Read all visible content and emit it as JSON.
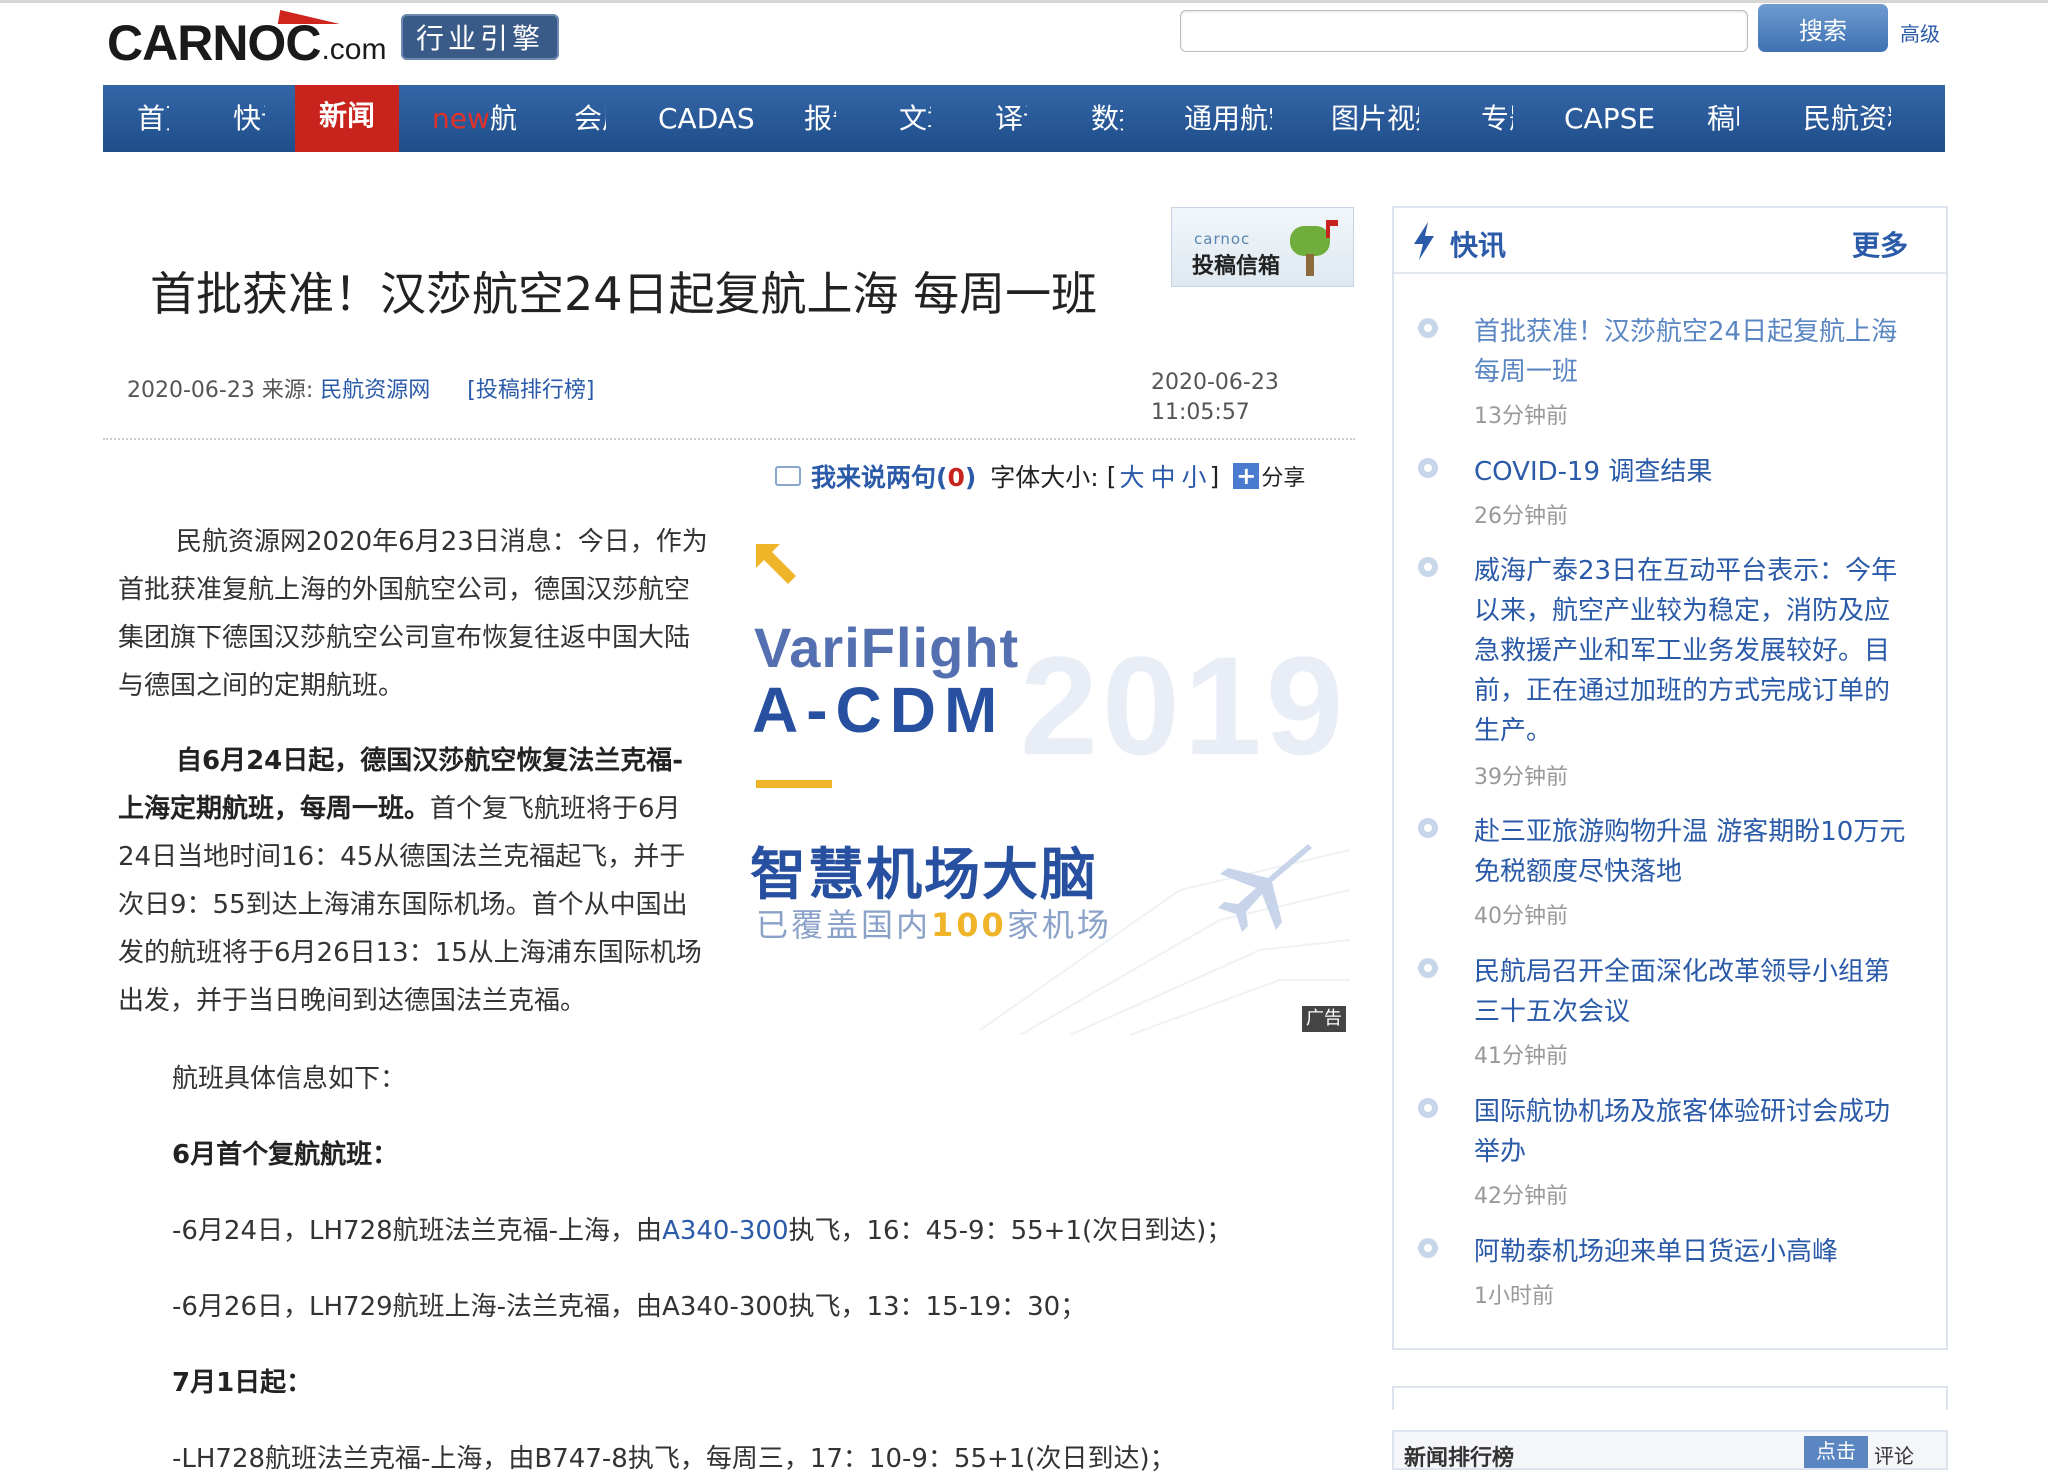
{
  "header": {
    "logo_main": "CARNOC",
    "logo_com": ".com",
    "badge": "行业引擎",
    "search_placeholder": "",
    "search_button": "搜索",
    "advanced": "高级"
  },
  "nav": [
    {
      "label": "首页",
      "left": 0
    },
    {
      "label": "快讯"
    },
    {
      "label": "新闻",
      "active": true
    },
    {
      "label_new": "new",
      "label": "航旅"
    },
    {
      "label": "会展"
    },
    {
      "label": "CADAS"
    },
    {
      "label": "报告"
    },
    {
      "label": "文章"
    },
    {
      "label": "译讯"
    },
    {
      "label": "数据"
    },
    {
      "label": "通用航空"
    },
    {
      "label": "图片视频"
    },
    {
      "label": "专题"
    },
    {
      "label": "CAPSE"
    },
    {
      "label": "稿明"
    },
    {
      "label": "民航资料"
    }
  ],
  "article": {
    "title": "首批获准！汉莎航空24日起复航上海 每周一班",
    "date": "2020-06-23",
    "source_label": "来源:",
    "source": "民航资源网",
    "rank_link": "投稿排行榜",
    "time_date": "2020-06-23",
    "time_clock": "11:05:57",
    "tougao_small": "carnoc",
    "tougao": "投稿信箱",
    "comment_label": "我来说两句",
    "comment_count": "0",
    "font_size_label": "字体大小:",
    "font_large": "大",
    "font_medium": "中",
    "font_small": "小",
    "share": "分享",
    "p1": "民航资源网2020年6月23日消息：今日，作为首批获准复航上海的外国航空公司，德国汉莎航空集团旗下德国汉莎航空公司宣布恢复往返中国大陆与德国之间的定期航班。",
    "p2_bold": "自6月24日起，德国汉莎航空恢复法兰克福-上海定期航班，每周一班。",
    "p2_rest": "首个复飞航班将于6月24日当地时间16：45从德国法兰克福起飞，并于次日9：55到达上海浦东国际机场。首个从中国出发的航班将于6月26日13：15从上海浦东国际机场出发，并于当日晚间到达德国法兰克福。",
    "p3": "航班具体信息如下：",
    "h1": "6月首个复航航班：",
    "l1_a": "-6月24日，LH728航班法兰克福-上海，由",
    "l1_link": "A340-300",
    "l1_b": "执飞，16：45-9：55+1(次日到达)；",
    "l2": "-6月26日，LH729航班上海-法兰克福，由A340-300执飞，13：15-19：30；",
    "h2": "7月1日起：",
    "l3": "-LH728航班法兰克福-上海，由B747-8执飞，每周三，17：10-9：55+1(次日到达)；"
  },
  "ad": {
    "brand1": "VariFlight",
    "brand2": "A-CDM",
    "year": "2019",
    "headline": "智慧机场大脑",
    "sub_a": "已覆盖国内",
    "sub_num": "100",
    "sub_b": "家机场",
    "tag": "广告",
    "colors": {
      "brand": "#2850a0",
      "accent": "#f0b429"
    }
  },
  "sidebar": {
    "title": "快讯",
    "more": "更多",
    "items": [
      {
        "text": "首批获准！汉莎航空24日起复航上海 每周一班",
        "time": "13分钟前"
      },
      {
        "text": "COVID-19 调查结果",
        "time": "26分钟前"
      },
      {
        "text": "威海广泰23日在互动平台表示：今年以来，航空产业较为稳定，消防及应急救援产业和军工业务发展较好。目前，正在通过加班的方式完成订单的生产。",
        "time": "39分钟前"
      },
      {
        "text": "赴三亚旅游购物升温 游客期盼10万元免税额度尽快落地",
        "time": "40分钟前"
      },
      {
        "text": "民航局召开全面深化改革领导小组第三十五次会议",
        "time": "41分钟前"
      },
      {
        "text": "国际航协机场及旅客体验研讨会成功举办",
        "time": "42分钟前"
      },
      {
        "text": "阿勒泰机场迎来单日货运小高峰",
        "time": "1小时前"
      }
    ],
    "rank_title": "新闻排行榜",
    "rank_tab1": "点击",
    "rank_tab2": "评论"
  }
}
